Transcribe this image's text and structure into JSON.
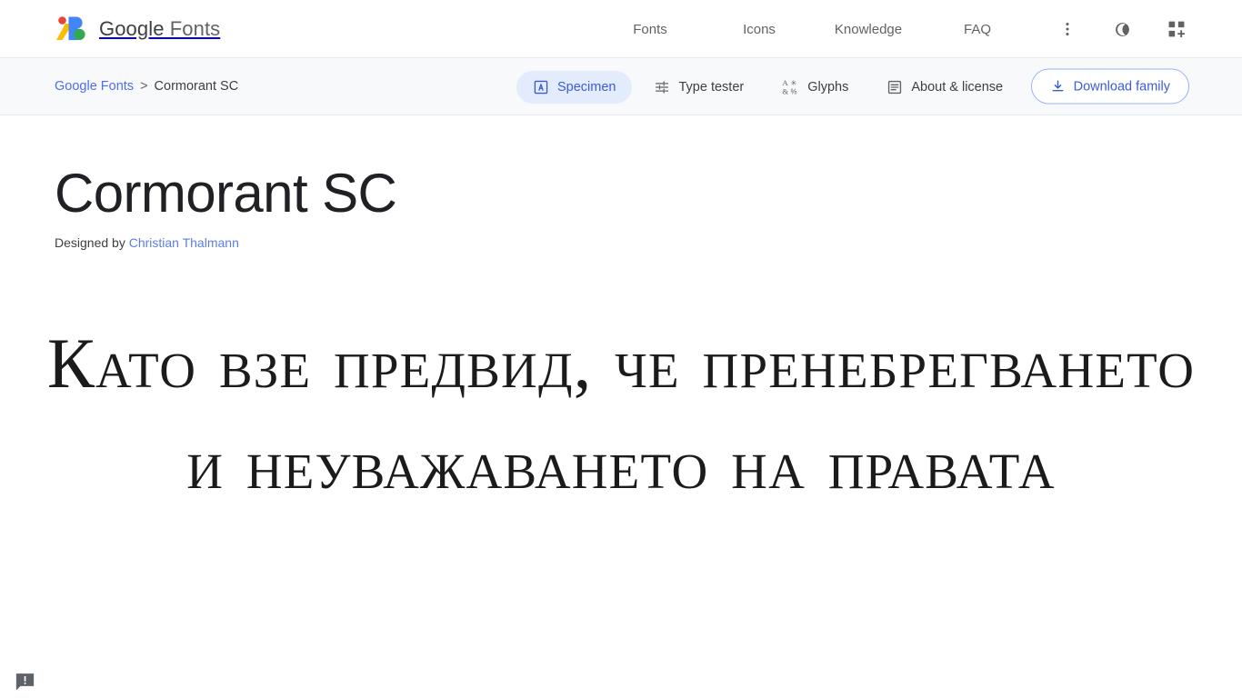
{
  "header": {
    "brand": {
      "text_bold": "Google",
      "text_light": " Fonts",
      "icon": "google-fonts-logo"
    },
    "nav": [
      {
        "label": "Fonts",
        "icon": "fonts-nav-item"
      },
      {
        "label": "Icons",
        "icon": "icons-nav-item"
      },
      {
        "label": "Knowledge",
        "icon": "knowledge-nav-item"
      },
      {
        "label": "FAQ",
        "icon": "faq-nav-item"
      }
    ],
    "actions": [
      {
        "name": "more-options-icon",
        "title": "More options"
      },
      {
        "name": "dark-mode-icon",
        "title": "Dark mode"
      },
      {
        "name": "apps-add-icon",
        "title": "Google apps"
      }
    ]
  },
  "subheader": {
    "breadcrumb": {
      "root": "Google Fonts",
      "separator": ">",
      "current": "Cormorant SC"
    },
    "tabs": [
      {
        "label": "Specimen",
        "icon": "specimen-icon",
        "active": true
      },
      {
        "label": "Type tester",
        "icon": "tune-icon",
        "active": false
      },
      {
        "label": "Glyphs",
        "icon": "glyphs-icon",
        "active": false
      },
      {
        "label": "About & license",
        "icon": "article-icon",
        "active": false
      }
    ],
    "download_button": {
      "label": "Download family",
      "icon": "download-icon"
    }
  },
  "main": {
    "font_name": "Cormorant SC",
    "designed_by_prefix": "Designed by ",
    "designer_name": "Christian Thalmann",
    "specimen_text": "Като взе предвид, че пренебрегването и неуважаването на правата"
  },
  "footer": {
    "feedback_icon": "feedback-icon"
  },
  "colors": {
    "accent_blue": "#3b5bdb",
    "link_blue": "#4c6ef5",
    "active_tab_bg": "#e3ecfd",
    "text_primary": "#202124",
    "text_secondary": "#5f6368",
    "subheader_bg": "#f8f9fa",
    "border": "#e8eaed"
  }
}
